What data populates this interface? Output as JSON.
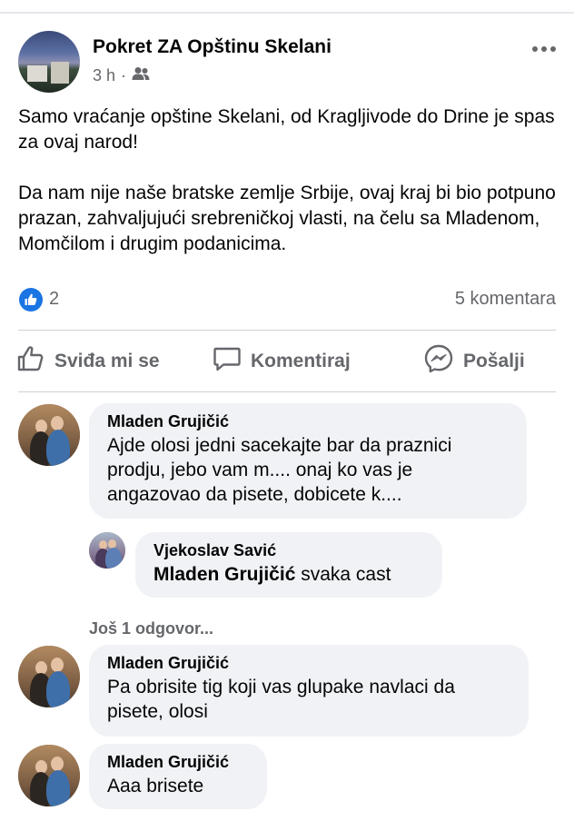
{
  "post": {
    "page_name": "Pokret ZA Opštinu Skelani",
    "time": "3 h",
    "separator": "·",
    "audience_icon": "friends-icon",
    "more_icon": "more-horizontal-icon",
    "paragraphs": [
      "Samo vraćanje opštine Skelani, od Kragljivode do Drine je spas za ovaj narod!",
      "Da nam nije naše bratske zemlje Srbije, ovaj kraj bi bio potpuno prazan, zahvaljujući srebreničkoj vlasti, na čelu sa Mladenom, Momčilom i drugim podanicima."
    ],
    "reactions": {
      "icon": "like-reaction-icon",
      "count": "2"
    },
    "comment_count": "5 komentara"
  },
  "actions": {
    "like": {
      "label": "Sviđa mi se",
      "icon": "thumbs-up-icon"
    },
    "comment": {
      "label": "Komentiraj",
      "icon": "comment-bubble-icon"
    },
    "send": {
      "label": "Pošalji",
      "icon": "messenger-icon"
    }
  },
  "comments": [
    {
      "author": "Mladen Grujičić",
      "text": "Ajde olosi jedni sacekajte bar da praznici prodju, jebo vam m.... onaj ko vas je angazovao da pisete, dobicete k...."
    },
    {
      "author": "Vjekoslav Savić",
      "mention": "Mladen Grujičić",
      "text": " svaka cast"
    },
    {
      "author": "Mladen Grujičić",
      "text": "Pa obrisite tig koji vas glupake navlaci da pisete, olosi"
    },
    {
      "author": "Mladen Grujičić",
      "text": "Aaa brisete"
    }
  ],
  "more_replies": "Još 1 odgovor...",
  "colors": {
    "accent": "#1b74e4",
    "secondary_text": "#65676b",
    "bubble_bg": "#f0f2f5",
    "divider": "#ced0d4"
  }
}
